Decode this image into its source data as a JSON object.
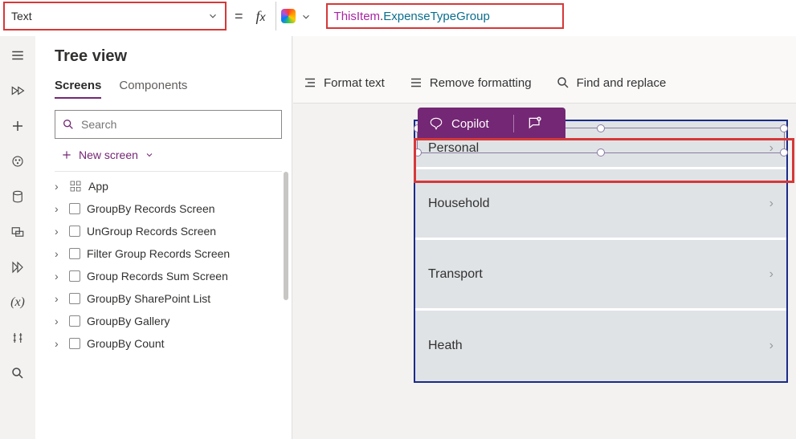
{
  "property_dropdown": {
    "value": "Text"
  },
  "formula": {
    "this": "ThisItem",
    "ident": "ExpenseTypeGroup"
  },
  "toolbar": {
    "format_text": "Format text",
    "remove_formatting": "Remove formatting",
    "find_replace": "Find and replace"
  },
  "panel": {
    "title": "Tree view",
    "tabs": {
      "screens": "Screens",
      "components": "Components"
    },
    "search_placeholder": "Search",
    "new_screen": "New screen"
  },
  "tree": {
    "app": "App",
    "items": [
      "GroupBy Records Screen",
      "UnGroup Records Screen",
      "Filter Group Records Screen",
      "Group Records Sum Screen",
      "GroupBy SharePoint List",
      "GroupBy Gallery",
      "GroupBy Count"
    ]
  },
  "copilot": {
    "label": "Copilot"
  },
  "gallery": {
    "rows": [
      "Personal",
      "Household",
      "Transport",
      "Heath"
    ]
  }
}
